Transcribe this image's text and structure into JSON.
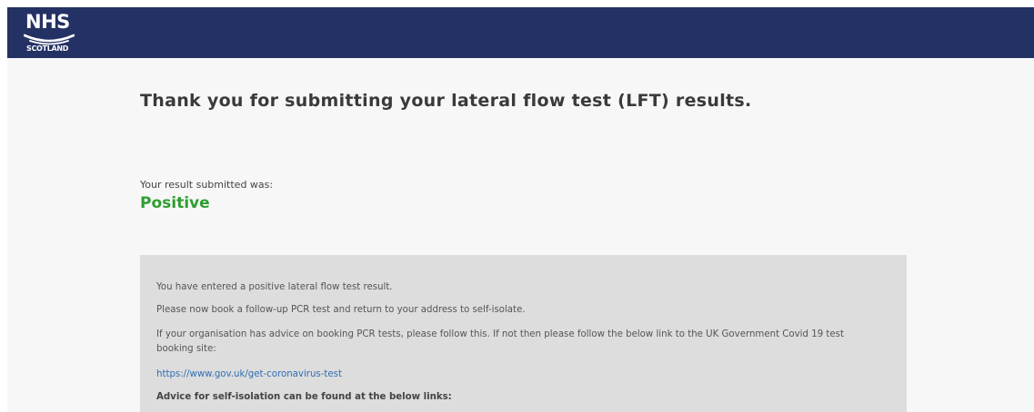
{
  "header": {
    "logo": {
      "primary": "NHS",
      "secondary": "SCOTLAND"
    },
    "background_color": "#233164"
  },
  "main": {
    "title": "Thank you for submitting your lateral flow test (LFT) results.",
    "result_label": "Your result submitted was:",
    "result_value": "Positive",
    "result_color": "#2e9e2e",
    "info": {
      "line1": "You have entered a positive lateral flow test result.",
      "line2": "Please now book a follow-up PCR test and return to your address to self-isolate.",
      "line3": "If your organisation has advice on booking PCR tests, please follow this. If not then please follow the below link to the UK Government Covid 19 test booking site:",
      "link": "https://www.gov.uk/get-coronavirus-test",
      "link_color": "#2f6eb5",
      "advice_heading": "Advice for self-isolation can be found at the below links:"
    }
  }
}
